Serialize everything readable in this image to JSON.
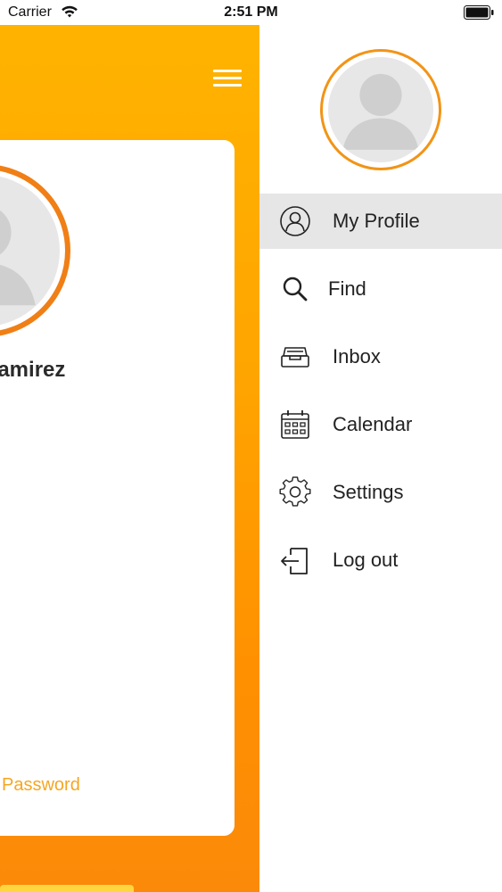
{
  "status_bar": {
    "carrier": "Carrier",
    "time": "2:51 PM"
  },
  "main": {
    "profile_name": "Ramirez",
    "password_link": "Password",
    "accent_color": "#ffa500"
  },
  "menu": {
    "items": [
      {
        "label": "My Profile",
        "icon": "profile-icon",
        "active": true
      },
      {
        "label": "Find",
        "icon": "search-icon",
        "active": false
      },
      {
        "label": "Inbox",
        "icon": "inbox-icon",
        "active": false
      },
      {
        "label": "Calendar",
        "icon": "calendar-icon",
        "active": false
      },
      {
        "label": "Settings",
        "icon": "gear-icon",
        "active": false
      },
      {
        "label": "Log out",
        "icon": "logout-icon",
        "active": false
      }
    ]
  }
}
